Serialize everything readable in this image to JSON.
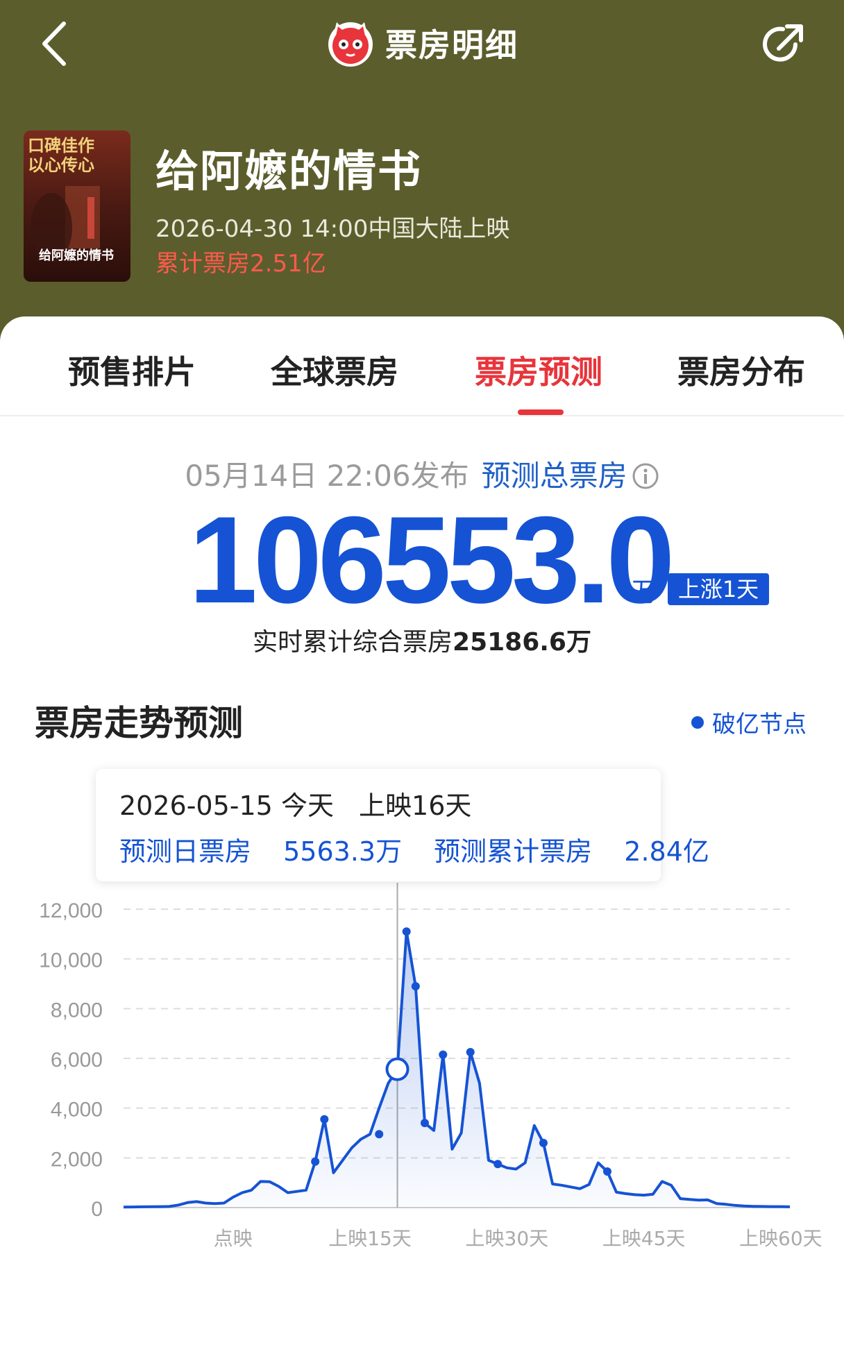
{
  "header": {
    "title": "票房明细",
    "movie_title": "给阿嬷的情书",
    "release_info": "2026-04-30 14:00中国大陆上映",
    "cumulative_box": "累计票房2.51亿",
    "poster": {
      "slogan_line1": "口碑佳作",
      "slogan_line2": "以心传心",
      "poster_title": "给阿嬷的情书"
    }
  },
  "tabs": [
    {
      "label": "预售排片",
      "active": false
    },
    {
      "label": "全球票房",
      "active": false
    },
    {
      "label": "票房预测",
      "active": true
    },
    {
      "label": "票房分布",
      "active": false
    }
  ],
  "forecast": {
    "published_time": "05月14日 22:06发布",
    "label": "预测总票房",
    "total": "106553.0",
    "unit": "万",
    "badge": "上涨1天",
    "realtime_label": "实时累计综合票房",
    "realtime_value": "25186.6万"
  },
  "trend": {
    "title": "票房走势预测",
    "legend": "破亿节点"
  },
  "tooltip": {
    "date": "2026-05-15",
    "today": "今天",
    "days_showing": "上映16天",
    "daily_label": "预测日票房",
    "daily_value": "5563.3万",
    "cumulative_label": "预测累计票房",
    "cumulative_value": "2.84亿"
  },
  "colors": {
    "header_bg": "#5b5d2c",
    "accent_red": "#e8343b",
    "primary_blue": "#1553d4",
    "cumulative_red": "#ff5a4d"
  },
  "chart_data": {
    "type": "area",
    "x_label_positions": [
      -3,
      12,
      27,
      42,
      57
    ],
    "x_tick_labels": [
      "点映",
      "上映15天",
      "上映30天",
      "上映45天",
      "上映60天"
    ],
    "y_ticks": [
      "12,000",
      "10,000",
      "8,000",
      "6,000",
      "4,000",
      "2,000",
      "0"
    ],
    "ylim": [
      0,
      12000
    ],
    "xlim": [
      -15,
      58
    ],
    "grid": true,
    "highlight_x": 15,
    "highlight_y": 5563,
    "series": [
      {
        "points": [
          [
            -15,
            20
          ],
          [
            -14,
            25
          ],
          [
            -13,
            30
          ],
          [
            -12,
            35
          ],
          [
            -11,
            40
          ],
          [
            -10,
            45
          ],
          [
            -9,
            100
          ],
          [
            -8,
            200
          ],
          [
            -7,
            240
          ],
          [
            -6,
            180
          ],
          [
            -5,
            160
          ],
          [
            -4,
            180
          ],
          [
            -3,
            420
          ],
          [
            -2,
            600
          ],
          [
            -1,
            700
          ],
          [
            0,
            1050
          ],
          [
            1,
            1040
          ],
          [
            2,
            850
          ],
          [
            3,
            600
          ],
          [
            4,
            650
          ],
          [
            5,
            700
          ],
          [
            6,
            1850
          ],
          [
            7,
            3550
          ],
          [
            8,
            1400
          ],
          [
            9,
            1900
          ],
          [
            10,
            2400
          ],
          [
            11,
            2750
          ],
          [
            12,
            2950
          ],
          [
            13,
            4000
          ],
          [
            14,
            5000
          ],
          [
            15,
            5563
          ],
          [
            16,
            11100
          ],
          [
            17,
            8900
          ],
          [
            18,
            3400
          ],
          [
            19,
            3100
          ],
          [
            20,
            6150
          ],
          [
            21,
            2350
          ],
          [
            22,
            3000
          ],
          [
            23,
            6250
          ],
          [
            24,
            5000
          ],
          [
            25,
            1900
          ],
          [
            26,
            1750
          ],
          [
            27,
            1600
          ],
          [
            28,
            1550
          ],
          [
            29,
            1800
          ],
          [
            30,
            3300
          ],
          [
            31,
            2600
          ],
          [
            32,
            950
          ],
          [
            33,
            900
          ],
          [
            34,
            830
          ],
          [
            35,
            760
          ],
          [
            36,
            930
          ],
          [
            37,
            1800
          ],
          [
            38,
            1450
          ],
          [
            39,
            620
          ],
          [
            40,
            560
          ],
          [
            41,
            520
          ],
          [
            42,
            500
          ],
          [
            43,
            540
          ],
          [
            44,
            1050
          ],
          [
            45,
            900
          ],
          [
            46,
            360
          ],
          [
            47,
            330
          ],
          [
            48,
            300
          ],
          [
            49,
            310
          ],
          [
            50,
            160
          ],
          [
            51,
            130
          ],
          [
            52,
            90
          ],
          [
            53,
            60
          ],
          [
            54,
            50
          ],
          [
            55,
            45
          ],
          [
            56,
            40
          ],
          [
            57,
            38
          ],
          [
            58,
            30
          ]
        ],
        "markers": [
          [
            6,
            1850
          ],
          [
            7,
            3550
          ],
          [
            13,
            2950
          ],
          [
            16,
            11100
          ],
          [
            17,
            8900
          ],
          [
            18,
            3400
          ],
          [
            20,
            6150
          ],
          [
            23,
            6250
          ],
          [
            26,
            1750
          ],
          [
            31,
            2600
          ],
          [
            38,
            1450
          ]
        ]
      }
    ]
  }
}
